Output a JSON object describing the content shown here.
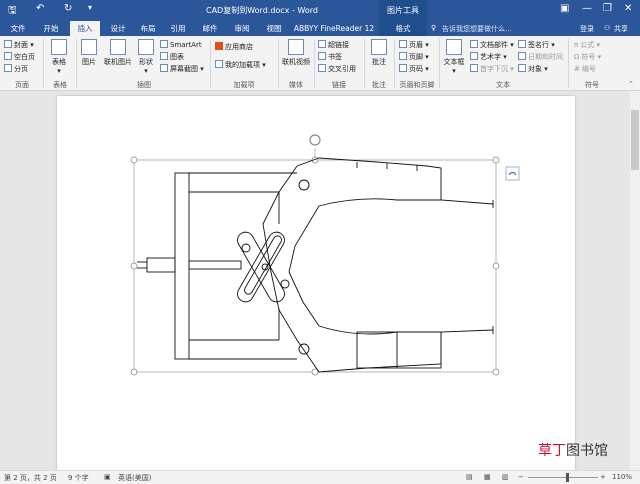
{
  "title_bar": {
    "document_title": "CAD复制到Word.docx - Word",
    "context_title": "图片工具",
    "undo_icon": "undo-icon",
    "redo_icon": "redo-icon",
    "save_icon": "save-icon"
  },
  "tabs": [
    {
      "label": "文件"
    },
    {
      "label": "开始"
    },
    {
      "label": "插入"
    },
    {
      "label": "设计"
    },
    {
      "label": "布局"
    },
    {
      "label": "引用"
    },
    {
      "label": "邮件"
    },
    {
      "label": "审阅"
    },
    {
      "label": "视图"
    },
    {
      "label": "ABBYY FineReader 12"
    },
    {
      "label": "格式"
    }
  ],
  "active_tab": "插入",
  "tell_me": "告诉我您想要做什么...",
  "sign_in": "登录",
  "share": "共享",
  "ribbon": {
    "pages": {
      "cover": "封面",
      "blank": "空白页",
      "break": "分页",
      "label": "页面"
    },
    "tables": {
      "table": "表格",
      "label": "表格"
    },
    "illustrations": {
      "picture": "图片",
      "online_picture": "联机图片",
      "shapes": "形状",
      "smartart": "SmartArt",
      "chart": "图表",
      "screenshot": "屏幕截图",
      "label": "插图"
    },
    "addins": {
      "store": "应用商店",
      "my_addins": "我的加载项",
      "label": "加载项"
    },
    "media": {
      "online_video": "联机视频",
      "label": "媒体"
    },
    "links": {
      "hyperlink": "超链接",
      "bookmark": "书签",
      "cross_ref": "交叉引用",
      "label": "链接"
    },
    "comments": {
      "comment": "批注",
      "label": "批注"
    },
    "header_footer": {
      "header": "页眉",
      "footer": "页脚",
      "page_number": "页码",
      "label": "页眉和页脚"
    },
    "text": {
      "textbox": "文本框",
      "quick_parts": "文档部件",
      "wordart": "艺术字",
      "dropcap": "首字下沉",
      "signature": "签名行",
      "datetime": "日期和时间",
      "object": "对象",
      "label": "文本"
    },
    "symbols": {
      "equation": "公式",
      "symbol": "符号",
      "number": "编号",
      "label": "符号"
    }
  },
  "status": {
    "page": "第 2 页，共 2 页",
    "words": "9 个字",
    "language": "英语(美国)",
    "zoom": "110%"
  },
  "watermark": {
    "part1": "草丁",
    "part2": "图书馆"
  }
}
